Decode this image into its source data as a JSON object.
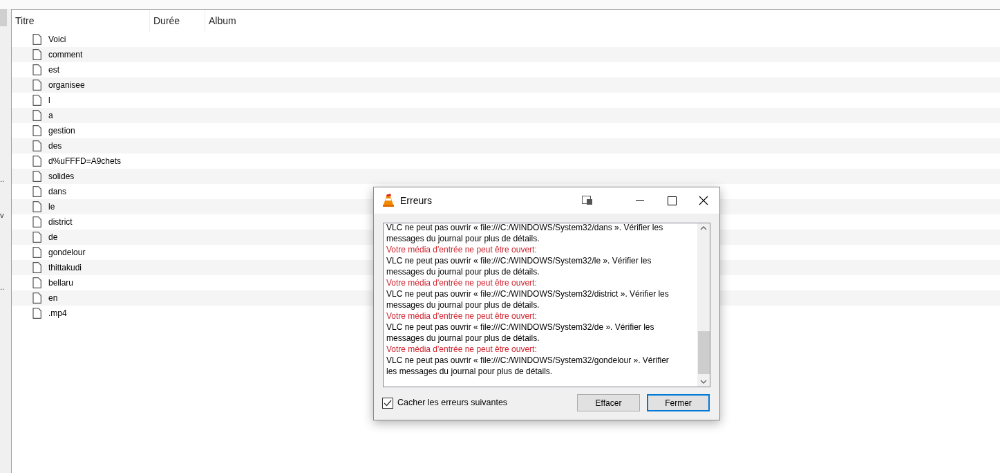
{
  "sidebar": {
    "items": [
      {
        "label": ".."
      },
      {
        "label": "v"
      },
      {
        "label": ".."
      }
    ]
  },
  "playlist": {
    "columns": [
      "Titre",
      "Durée",
      "Album"
    ],
    "rows": [
      {
        "title": "Voici"
      },
      {
        "title": "comment"
      },
      {
        "title": "est"
      },
      {
        "title": "organisee"
      },
      {
        "title": "l"
      },
      {
        "title": "a"
      },
      {
        "title": "gestion"
      },
      {
        "title": "des"
      },
      {
        "title": "d%uFFFD=A9chets"
      },
      {
        "title": "solides"
      },
      {
        "title": "dans"
      },
      {
        "title": "le"
      },
      {
        "title": "district"
      },
      {
        "title": "de"
      },
      {
        "title": "gondelour"
      },
      {
        "title": "thittakudi"
      },
      {
        "title": "bellaru"
      },
      {
        "title": "en"
      },
      {
        "title": ".mp4"
      }
    ]
  },
  "dialog": {
    "title": "Erreurs",
    "messages": [
      {
        "kind": "detail",
        "text": "VLC ne peut pas ouvrir « file:///C:/WINDOWS/System32/dans ». Vérifier les messages du journal pour plus de détails."
      },
      {
        "kind": "error",
        "text": "Votre média d'entrée ne peut être ouvert:"
      },
      {
        "kind": "detail",
        "text": "VLC ne peut pas ouvrir « file:///C:/WINDOWS/System32/le ». Vérifier les messages du journal pour plus de détails."
      },
      {
        "kind": "error",
        "text": "Votre média d'entrée ne peut être ouvert:"
      },
      {
        "kind": "detail",
        "text": "VLC ne peut pas ouvrir « file:///C:/WINDOWS/System32/district ». Vérifier les messages du journal pour plus de détails."
      },
      {
        "kind": "error",
        "text": "Votre média d'entrée ne peut être ouvert:"
      },
      {
        "kind": "detail",
        "text": "VLC ne peut pas ouvrir « file:///C:/WINDOWS/System32/de ». Vérifier les messages du journal pour plus de détails."
      },
      {
        "kind": "error",
        "text": "Votre média d'entrée ne peut être ouvert:"
      },
      {
        "kind": "detail",
        "text": "VLC ne peut pas ouvrir « file:///C:/WINDOWS/System32/gondelour ». Vérifier les messages du journal pour plus de détails."
      }
    ],
    "hide_errors": {
      "label": "Cacher les erreurs suivantes",
      "checked": true
    },
    "buttons": [
      {
        "label": "Effacer",
        "selected": false
      },
      {
        "label": "Fermer",
        "selected": true
      }
    ]
  }
}
